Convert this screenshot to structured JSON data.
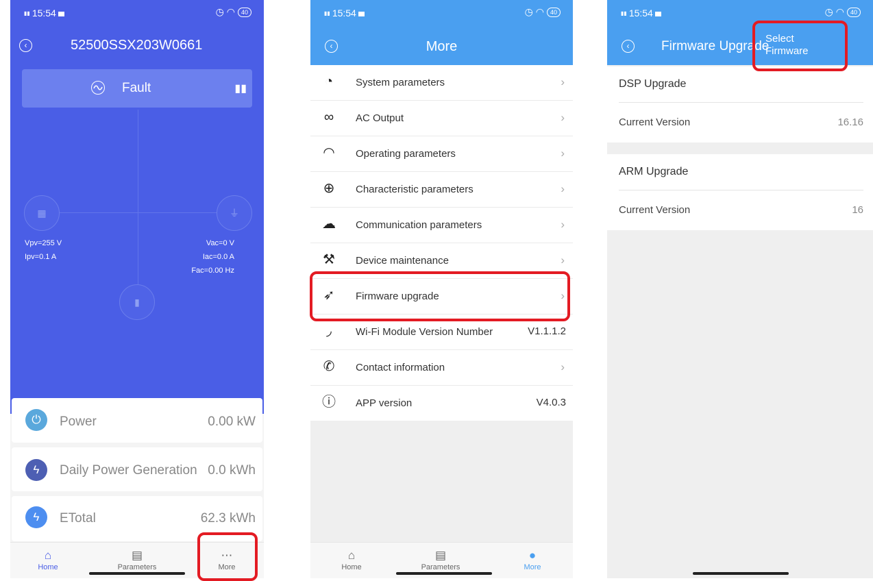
{
  "status": {
    "time": "15:54",
    "net": "4G",
    "battery": "40"
  },
  "home": {
    "device_id": "52500SSX203W0661",
    "status_label": "Fault",
    "readings_left": [
      "Vpv=255 V",
      "Ipv=0.1 A"
    ],
    "readings_right": [
      "Vac=0 V",
      "Iac=0.0 A",
      "Fac=0.00 Hz"
    ],
    "stats": [
      {
        "label": "Power",
        "value": "0.00 kW",
        "color": "#5aa8dc"
      },
      {
        "label": "Daily Power Generation",
        "value": "0.0 kWh",
        "color": "#4d5fb3"
      },
      {
        "label": "ETotal",
        "value": "62.3 kWh",
        "color": "#4d8ef0"
      }
    ],
    "tabs": [
      "Home",
      "Parameters",
      "More"
    ]
  },
  "more": {
    "title": "More",
    "items": [
      {
        "label": "System parameters",
        "value": ""
      },
      {
        "label": "AC Output",
        "value": ""
      },
      {
        "label": "Operating parameters",
        "value": ""
      },
      {
        "label": "Characteristic parameters",
        "value": ""
      },
      {
        "label": "Communication parameters",
        "value": ""
      },
      {
        "label": "Device maintenance",
        "value": ""
      },
      {
        "label": "Firmware upgrade",
        "value": ""
      },
      {
        "label": "Wi-Fi Module Version Number",
        "value": "V1.1.1.2"
      },
      {
        "label": "Contact information",
        "value": ""
      },
      {
        "label": "APP version",
        "value": "V4.0.3"
      }
    ],
    "tabs": [
      "Home",
      "Parameters",
      "More"
    ]
  },
  "firmware": {
    "title": "Firmware Upgrade",
    "select_line1": "Select",
    "select_line2": "Firmware",
    "dsp": {
      "heading": "DSP Upgrade",
      "row_label": "Current Version",
      "version": "16.16"
    },
    "arm": {
      "heading": "ARM Upgrade",
      "row_label": "Current Version",
      "version": "16"
    }
  },
  "colors": {
    "primary_blue": "#4a5ee6",
    "header_blue": "#4a9ff0",
    "highlight_red": "#e31b23"
  }
}
